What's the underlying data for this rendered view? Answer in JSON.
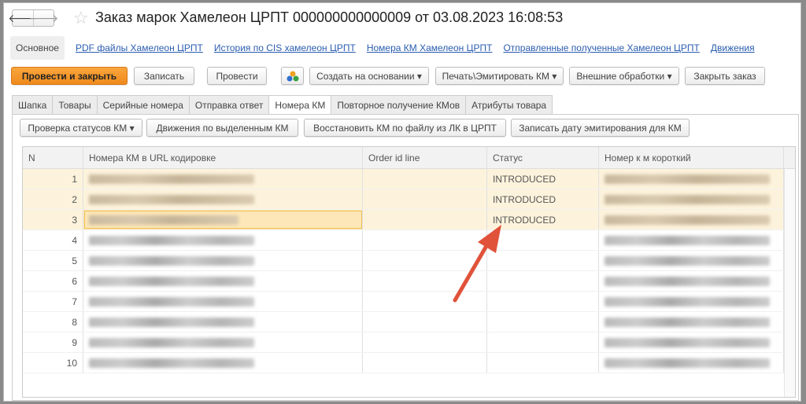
{
  "window": {
    "title": "Заказ марок Хамелеон ЦРПТ 000000000000009 от 03.08.2023 16:08:53",
    "back": "🡐",
    "forward": "🡒"
  },
  "links": [
    "Основное",
    "PDF файлы  Хамелеон ЦРПТ",
    "История по CIS хамелеон ЦРПТ",
    "Номера КМ Хамелеон ЦРПТ",
    "Отправленные полученные Хамелеон ЦРПТ",
    "Движения"
  ],
  "toolbar": {
    "post_close": "Провести и закрыть",
    "save": "Записать",
    "post": "Провести",
    "create_based": "Создать на основании ▾",
    "print": "Печать\\Эмитировать КМ ▾",
    "external": "Внешние обработки ▾",
    "close_order": "Закрыть заказ"
  },
  "tabs": [
    "Шапка",
    "Товары",
    "Серийные номера",
    "Отправка ответ",
    "Номера КМ",
    "Повторное получение КМов",
    "Атрибуты товара"
  ],
  "subtoolbar": {
    "check": "Проверка статусов КМ ▾",
    "moves": "Движения по выделенным КМ",
    "restore": "Восстановить КМ по файлу из ЛК в ЦРПТ",
    "write_date": "Записать дату эмитирования для КМ"
  },
  "table": {
    "columns": [
      "N",
      "Номера КМ в URL кодировке",
      "Order id line",
      "Статус",
      "Номер к м короткий"
    ],
    "rows": [
      {
        "n": "1",
        "status": "INTRODUCED"
      },
      {
        "n": "2",
        "status": "INTRODUCED"
      },
      {
        "n": "3",
        "status": "INTRODUCED"
      },
      {
        "n": "4",
        "status": ""
      },
      {
        "n": "5",
        "status": ""
      },
      {
        "n": "6",
        "status": ""
      },
      {
        "n": "7",
        "status": ""
      },
      {
        "n": "8",
        "status": ""
      },
      {
        "n": "9",
        "status": ""
      },
      {
        "n": "10",
        "status": ""
      }
    ]
  },
  "colors": {
    "accent": "#ef8a1d",
    "arrow": "#e0523a",
    "selected_row": "#fdf3dc"
  }
}
